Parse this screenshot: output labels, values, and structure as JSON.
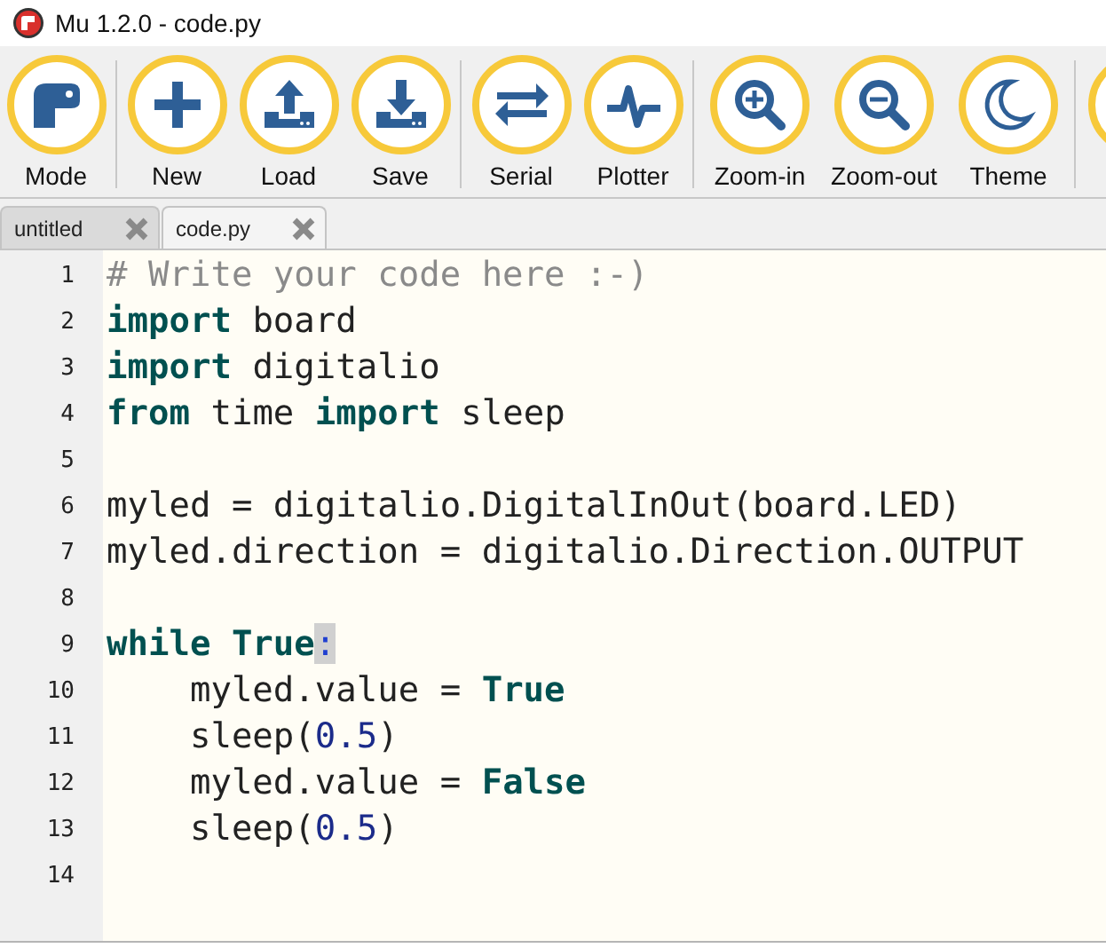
{
  "window": {
    "title": "Mu 1.2.0 - code.py"
  },
  "toolbar": [
    {
      "buttons": [
        {
          "kind": "mode",
          "label": "Mode"
        }
      ]
    },
    {
      "buttons": [
        {
          "kind": "new",
          "label": "New"
        },
        {
          "kind": "load",
          "label": "Load"
        },
        {
          "kind": "save",
          "label": "Save"
        }
      ]
    },
    {
      "buttons": [
        {
          "kind": "serial",
          "label": "Serial"
        },
        {
          "kind": "plotter",
          "label": "Plotter"
        }
      ]
    },
    {
      "buttons": [
        {
          "kind": "zoom-in",
          "label": "Zoom-in"
        },
        {
          "kind": "zoom-out",
          "label": "Zoom-out"
        },
        {
          "kind": "theme",
          "label": "Theme"
        }
      ]
    },
    {
      "buttons": [
        {
          "kind": "partial"
        }
      ]
    }
  ],
  "tabs": [
    {
      "label": "untitled",
      "selected": false
    },
    {
      "label": "code.py",
      "selected": true
    }
  ],
  "editor": {
    "lines": [
      {
        "number": "1",
        "tokens": [
          {
            "kind": "comment",
            "text": "# Write your code here :-)"
          }
        ]
      },
      {
        "number": "2",
        "tokens": [
          {
            "kind": "keyword",
            "text": "import"
          },
          {
            "kind": "plain",
            "text": " board"
          }
        ]
      },
      {
        "number": "3",
        "tokens": [
          {
            "kind": "keyword",
            "text": "import"
          },
          {
            "kind": "plain",
            "text": " digitalio"
          }
        ]
      },
      {
        "number": "4",
        "tokens": [
          {
            "kind": "keyword",
            "text": "from"
          },
          {
            "kind": "plain",
            "text": " time "
          },
          {
            "kind": "keyword",
            "text": "import"
          },
          {
            "kind": "plain",
            "text": " sleep"
          }
        ]
      },
      {
        "number": "5"
      },
      {
        "number": "6",
        "tokens": [
          {
            "kind": "plain",
            "text": "myled = digitalio.DigitalInOut(board.LED)"
          }
        ]
      },
      {
        "number": "7",
        "tokens": [
          {
            "kind": "plain",
            "text": "myled.direction = digitalio.Direction.OUTPUT"
          }
        ]
      },
      {
        "number": "8"
      },
      {
        "number": "9",
        "tokens": [
          {
            "kind": "keyword",
            "text": "while True"
          },
          {
            "kind": "match",
            "text": ":"
          }
        ]
      },
      {
        "number": "10",
        "tokens": [
          {
            "kind": "plain",
            "text": "    myled.value = "
          },
          {
            "kind": "keyword",
            "text": "True"
          }
        ]
      },
      {
        "number": "11",
        "tokens": [
          {
            "kind": "plain",
            "text": "    sleep("
          },
          {
            "kind": "number",
            "text": "0.5"
          },
          {
            "kind": "plain",
            "text": ")"
          }
        ]
      },
      {
        "number": "12",
        "tokens": [
          {
            "kind": "plain",
            "text": "    myled.value = "
          },
          {
            "kind": "keyword",
            "text": "False"
          }
        ]
      },
      {
        "number": "13",
        "tokens": [
          {
            "kind": "plain",
            "text": "    sleep("
          },
          {
            "kind": "number",
            "text": "0.5"
          },
          {
            "kind": "plain",
            "text": ")"
          }
        ]
      },
      {
        "number": "14"
      }
    ]
  }
}
